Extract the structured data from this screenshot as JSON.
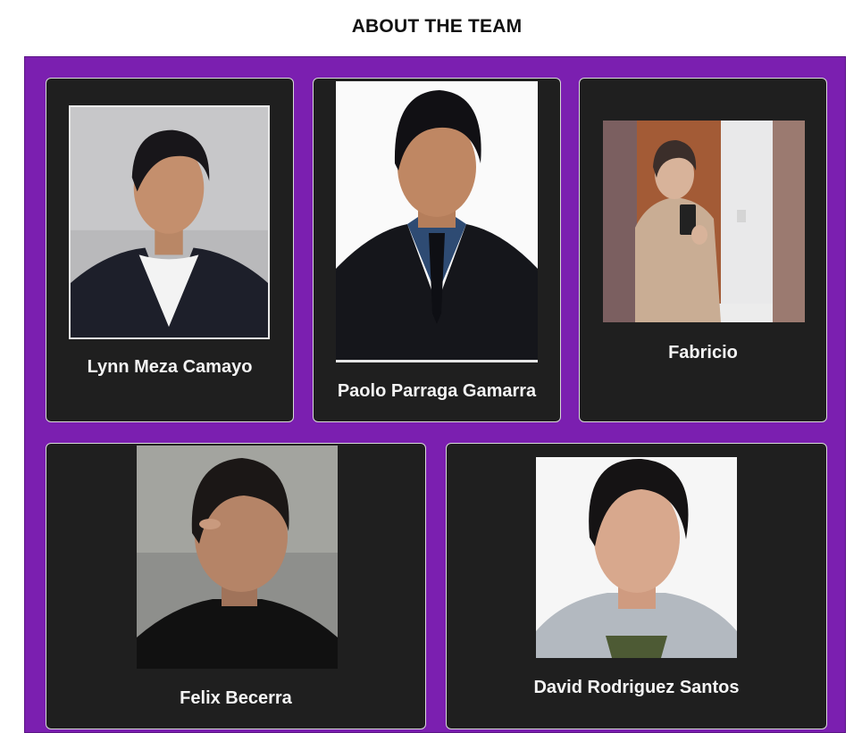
{
  "page": {
    "title": "ABOUT THE TEAM"
  },
  "team": [
    {
      "name": "Lynn Meza Camayo",
      "photo_icon": "portrait-icon"
    },
    {
      "name": "Paolo Parraga Gamarra",
      "photo_icon": "portrait-icon"
    },
    {
      "name": "Fabricio",
      "photo_icon": "portrait-icon"
    },
    {
      "name": "Felix Becerra",
      "photo_icon": "portrait-icon"
    },
    {
      "name": "David Rodriguez Santos",
      "photo_icon": "portrait-icon"
    }
  ],
  "colors": {
    "panel": "#7b1fb0",
    "card": "#1f1f1f",
    "name_text": "#f4f4f4"
  }
}
